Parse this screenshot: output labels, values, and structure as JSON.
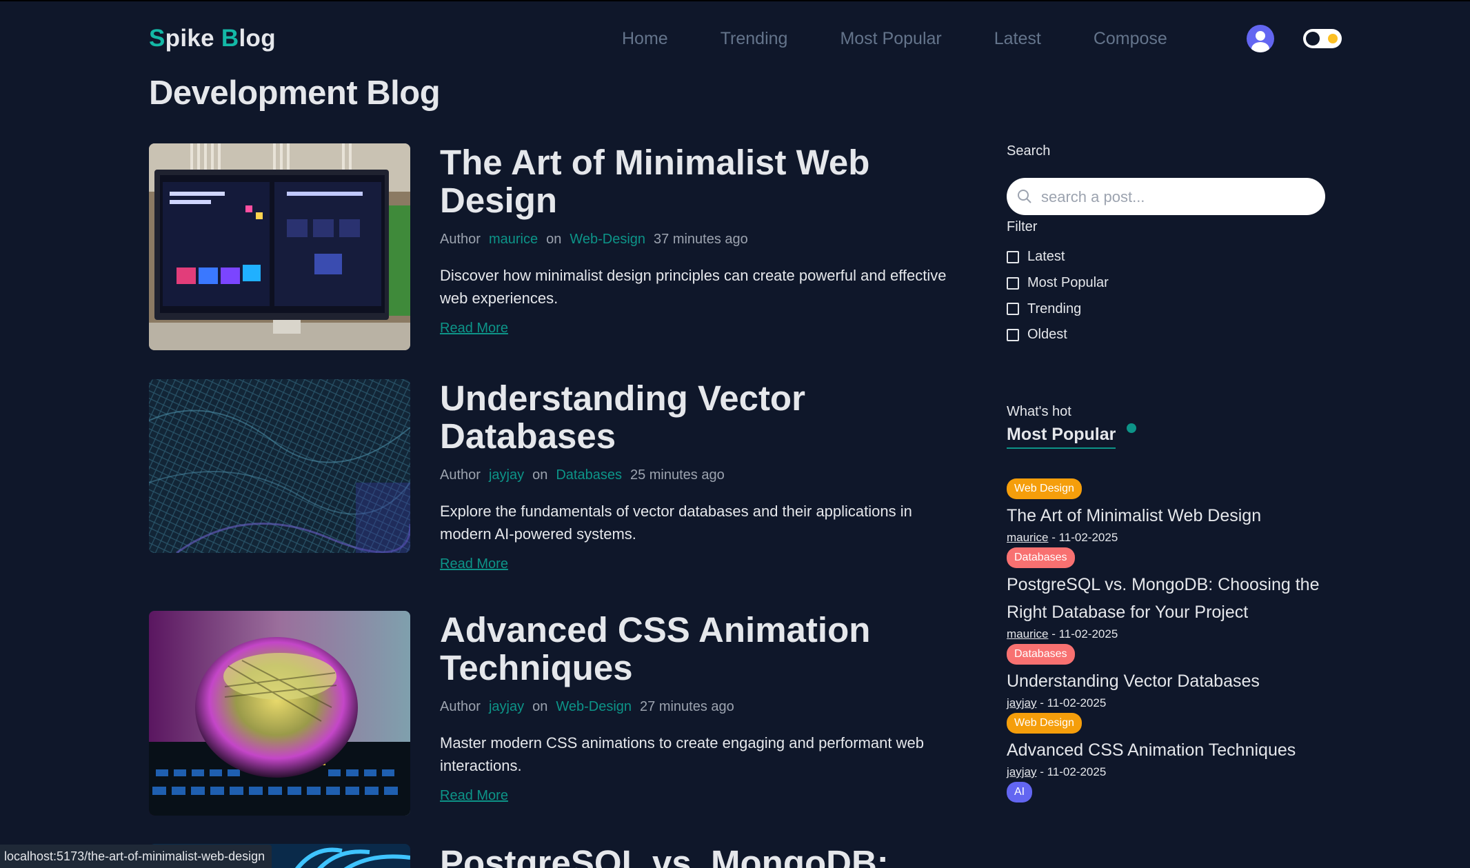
{
  "brand": {
    "part1_accent": "S",
    "part1": "pike ",
    "part2_accent": "B",
    "part2": "log"
  },
  "nav": {
    "links": [
      "Home",
      "Trending",
      "Most Popular",
      "Latest",
      "Compose"
    ]
  },
  "page": {
    "title": "Development Blog"
  },
  "posts": [
    {
      "title": "The Art of Minimalist Web Design",
      "author_prefix": "Author",
      "author": "maurice",
      "on": "on",
      "category": "Web-Design",
      "time": "37 minutes ago",
      "excerpt": "Discover how minimalist design principles can create powerful and effective web experiences.",
      "read_more": "Read More"
    },
    {
      "title": "Understanding Vector Databases",
      "author_prefix": "Author",
      "author": "jayjay",
      "on": "on",
      "category": "Databases",
      "time": "25 minutes ago",
      "excerpt": "Explore the fundamentals of vector databases and their applications in modern AI-powered systems.",
      "read_more": "Read More"
    },
    {
      "title": "Advanced CSS Animation Techniques",
      "author_prefix": "Author",
      "author": "jayjay",
      "on": "on",
      "category": "Web-Design",
      "time": "27 minutes ago",
      "excerpt": "Master modern CSS animations to create engaging and performant web interactions.",
      "read_more": "Read More"
    },
    {
      "title": "PostgreSQL vs. MongoDB:"
    }
  ],
  "sidebar": {
    "search_label": "Search",
    "search_placeholder": "search a post...",
    "filter_label": "Filter",
    "filters": [
      "Latest",
      "Most Popular",
      "Trending",
      "Oldest"
    ],
    "whats_hot": "What's hot",
    "most_popular": "Most Popular",
    "popular": [
      {
        "tag": "Web Design",
        "tag_color": "#f59e0b",
        "title": "The Art of Minimalist Web Design",
        "author": "maurice",
        "date": " - 11-02-2025"
      },
      {
        "tag": "Databases",
        "tag_color": "#f87171",
        "title": "PostgreSQL vs. MongoDB: Choosing the Right Database for Your Project",
        "author": "maurice",
        "date": " - 11-02-2025"
      },
      {
        "tag": "Databases",
        "tag_color": "#f87171",
        "title": "Understanding Vector Databases",
        "author": "jayjay",
        "date": " - 11-02-2025"
      },
      {
        "tag": "Web Design",
        "tag_color": "#f59e0b",
        "title": "Advanced CSS Animation Techniques",
        "author": "jayjay",
        "date": " - 11-02-2025"
      },
      {
        "tag": "AI",
        "tag_color": "#6366f1"
      }
    ]
  },
  "status_bar": {
    "url": "localhost:5173/the-art-of-minimalist-web-design"
  },
  "colors": {
    "background": "#0f172a",
    "accent": "#0d9488",
    "text": "#e5e7eb"
  }
}
